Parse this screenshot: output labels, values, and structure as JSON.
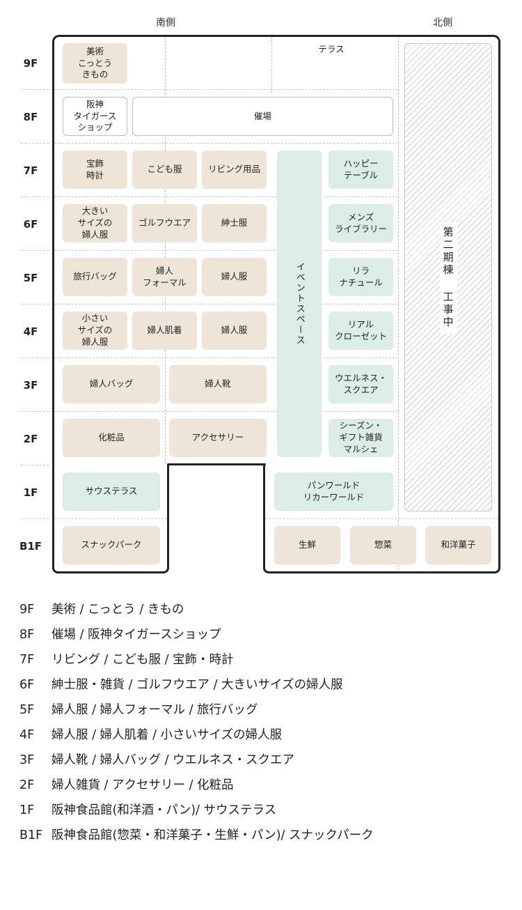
{
  "sides": {
    "south": "南側",
    "north": "北側"
  },
  "floors": [
    "9F",
    "8F",
    "7F",
    "6F",
    "5F",
    "4F",
    "3F",
    "2F",
    "1F",
    "B1F"
  ],
  "terrace": "テラス",
  "event_space": "イベントスペース",
  "construction": "第二期棟 工事中",
  "shops": {
    "f9_art": "美術\nこっとう\nきもの",
    "f8_tigers": "阪神\nタイガース\nショップ",
    "f8_hall": "催場",
    "f7_jewelry": "宝飾\n時計",
    "f7_kids": "こども服",
    "f7_living": "リビング用品",
    "f7_happy": "ハッピー\nテーブル",
    "f6_large": "大きい\nサイズの\n婦人服",
    "f6_golf": "ゴルフウエア",
    "f6_mens": "紳士服",
    "f6_library": "メンズ\nライブラリー",
    "f5_travel": "旅行バッグ",
    "f5_formal": "婦人\nフォーマル",
    "f5_women": "婦人服",
    "f5_relax": "リラ\nナチュール",
    "f4_small": "小さい\nサイズの\n婦人服",
    "f4_lingerie": "婦人肌着",
    "f4_women": "婦人服",
    "f4_closet": "リアル\nクローゼット",
    "f3_bag": "婦人バッグ",
    "f3_shoes": "婦人靴",
    "f3_wellness": "ウエルネス・\nスクエア",
    "f2_cosmetics": "化粧品",
    "f2_accessory": "アクセサリー",
    "f2_season": "シーズン・\nギフト雑貨\nマルシェ",
    "f1_south_terrace": "サウステラス",
    "f1_pan": "パンワールド\nリカーワールド",
    "b1_snack": "スナックパーク",
    "b1_fresh": "生鮮",
    "b1_deli": "惣菜",
    "b1_sweets": "和洋菓子"
  },
  "legend": [
    {
      "floor": "9F",
      "text": "美術 / こっとう / きもの"
    },
    {
      "floor": "8F",
      "text": "催場 / 阪神タイガースショップ"
    },
    {
      "floor": "7F",
      "text": "リビング / こども服 / 宝飾・時計"
    },
    {
      "floor": "6F",
      "text": "紳士服・雑貨 / ゴルフウエア / 大きいサイズの婦人服"
    },
    {
      "floor": "5F",
      "text": "婦人服 / 婦人フォーマル / 旅行バッグ"
    },
    {
      "floor": "4F",
      "text": "婦人服 / 婦人肌着 / 小さいサイズの婦人服"
    },
    {
      "floor": "3F",
      "text": "婦人靴 / 婦人バッグ / ウエルネス・スクエア"
    },
    {
      "floor": "2F",
      "text": "婦人雑貨 / アクセサリー / 化粧品"
    },
    {
      "floor": "1F",
      "text": "阪神食品館(和洋酒・パン)/ サウステラス"
    },
    {
      "floor": "B1F",
      "text": "阪神食品館(惣菜・和洋菓子・生鮮・パン)/ スナックパーク"
    }
  ],
  "colors": {
    "beige": "#eee4d8",
    "mint": "#dcece6",
    "outline": "#222222"
  }
}
